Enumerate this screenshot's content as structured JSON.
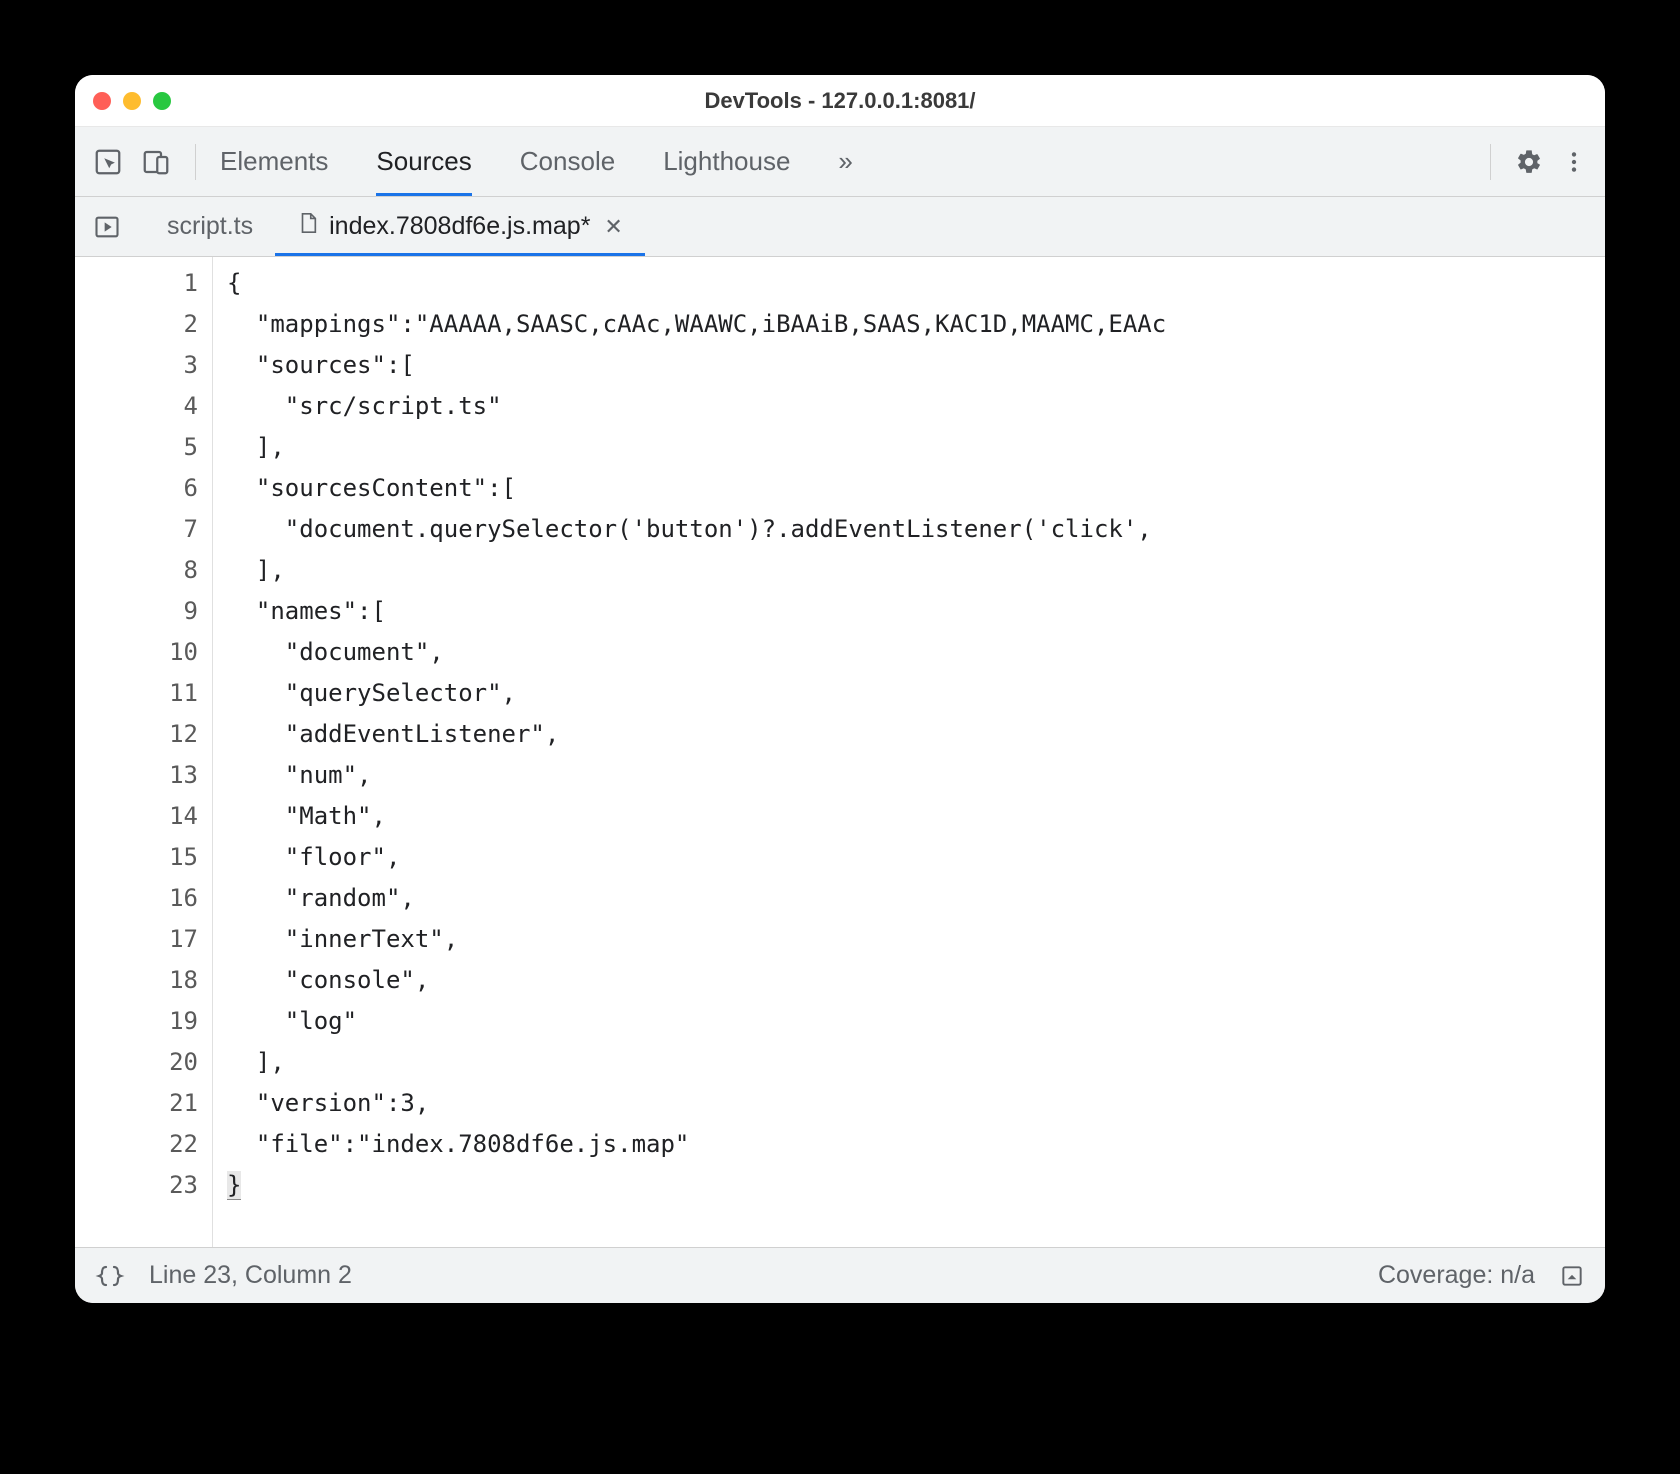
{
  "window": {
    "title": "DevTools - 127.0.0.1:8081/"
  },
  "panels": {
    "items": [
      "Elements",
      "Sources",
      "Console",
      "Lighthouse"
    ],
    "active": "Sources",
    "more_glyph": "»"
  },
  "files": {
    "tabs": [
      {
        "label": "script.ts",
        "active": false,
        "closeable": false
      },
      {
        "label": "index.7808df6e.js.map*",
        "active": true,
        "closeable": true
      }
    ]
  },
  "editor": {
    "line_count": 23,
    "lines": [
      "{",
      "  \"mappings\":\"AAAAA,SAASC,cAAc,WAAWC,iBAAiB,SAAS,KAC1D,MAAMC,EAAc",
      "  \"sources\":[",
      "    \"src/script.ts\"",
      "  ],",
      "  \"sourcesContent\":[",
      "    \"document.querySelector('button')?.addEventListener('click',",
      "  ],",
      "  \"names\":[",
      "    \"document\",",
      "    \"querySelector\",",
      "    \"addEventListener\",",
      "    \"num\",",
      "    \"Math\",",
      "    \"floor\",",
      "    \"random\",",
      "    \"innerText\",",
      "    \"console\",",
      "    \"log\"",
      "  ],",
      "  \"version\":3,",
      "  \"file\":\"index.7808df6e.js.map\"",
      "}"
    ]
  },
  "statusbar": {
    "cursor": "Line 23, Column 2",
    "coverage": "Coverage: n/a"
  }
}
